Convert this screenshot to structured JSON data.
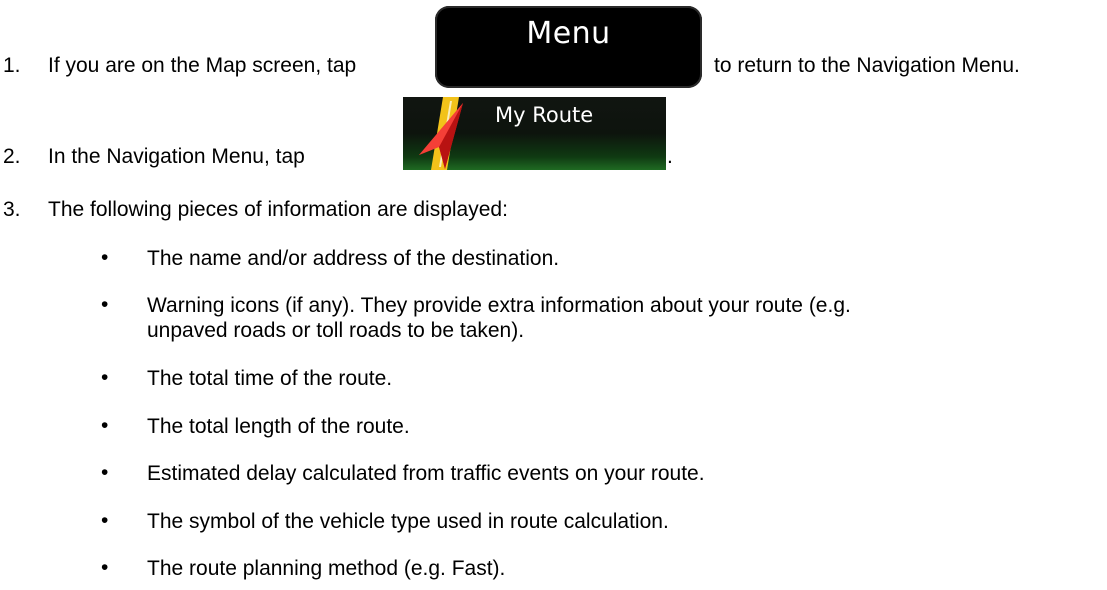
{
  "steps": [
    {
      "number": "1.",
      "text_before": "If you are on the Map screen, tap",
      "text_after": "to return to the Navigation Menu."
    },
    {
      "number": "2.",
      "text_before": "In the Navigation Menu, tap",
      "text_after": "."
    },
    {
      "number": "3.",
      "text": "The following pieces of information are displayed:"
    }
  ],
  "buttons": {
    "menu_label": "Menu",
    "my_route_label": "My Route"
  },
  "bullet_symbol": "•",
  "bullets": [
    "The name and/or address of the destination.",
    "Warning icons (if any). They provide extra information about your route (e.g. unpaved roads or toll roads to be taken).",
    "The total time of the route.",
    "The total length of the route.",
    "Estimated delay calculated from traffic events on your route.",
    "The symbol of the vehicle type used in route calculation.",
    "The route planning method (e.g. Fast)."
  ],
  "colors": {
    "text": "#000000",
    "menu_button_bg": "#000000",
    "route_button_bg": "#0f3a12",
    "route_arrow": "#e82020",
    "road_yellow": "#f2c21a"
  }
}
